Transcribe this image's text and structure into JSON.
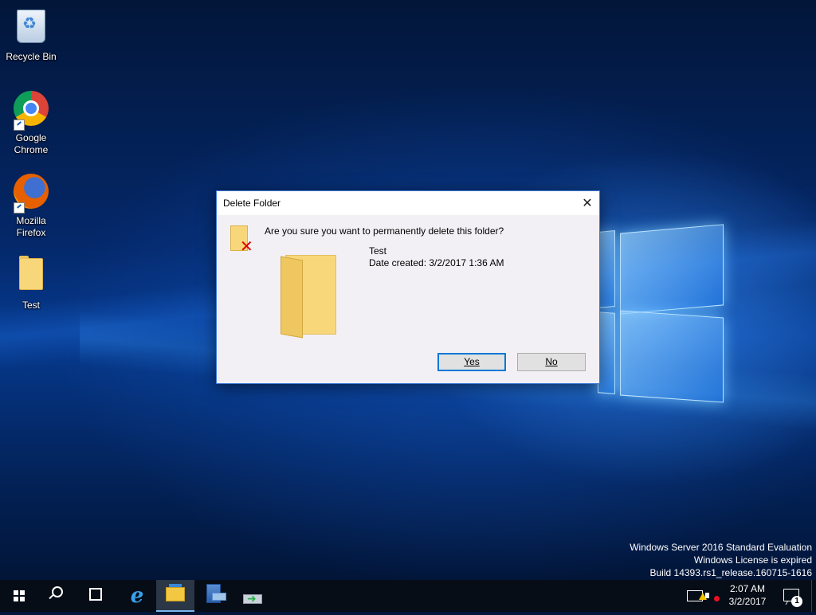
{
  "desktop": {
    "icons": [
      {
        "label": "Recycle Bin",
        "icon": "recycle-bin-icon"
      },
      {
        "label": "Google Chrome",
        "icon": "chrome-icon"
      },
      {
        "label": "Mozilla Firefox",
        "icon": "firefox-icon"
      },
      {
        "label": "Test",
        "icon": "folder-icon"
      }
    ]
  },
  "dialog": {
    "title": "Delete Folder",
    "close_label": "✕",
    "question": "Are you sure you want to permanently delete this folder?",
    "item_name": "Test",
    "item_date": "Date created: 3/2/2017 1:36 AM",
    "yes_label": "Yes",
    "no_label": "No"
  },
  "watermark": {
    "line1": "Windows Server 2016 Standard Evaluation",
    "line2": "Windows License is expired",
    "line3": "Build 14393.rs1_release.160715-1616"
  },
  "taskbar": {
    "buttons": [
      {
        "icon": "start-icon"
      },
      {
        "icon": "search-icon"
      },
      {
        "icon": "task-view-icon"
      },
      {
        "icon": "internet-explorer-icon"
      },
      {
        "icon": "file-explorer-icon",
        "active": true
      },
      {
        "icon": "server-manager-icon"
      },
      {
        "icon": "powershell-icon"
      }
    ],
    "clock_time": "2:07 AM",
    "clock_date": "3/2/2017",
    "notification_count": "1"
  },
  "colors": {
    "accent": "#0078d7",
    "taskbar": "#070d17",
    "dialog_bg": "#f3f0f5"
  }
}
